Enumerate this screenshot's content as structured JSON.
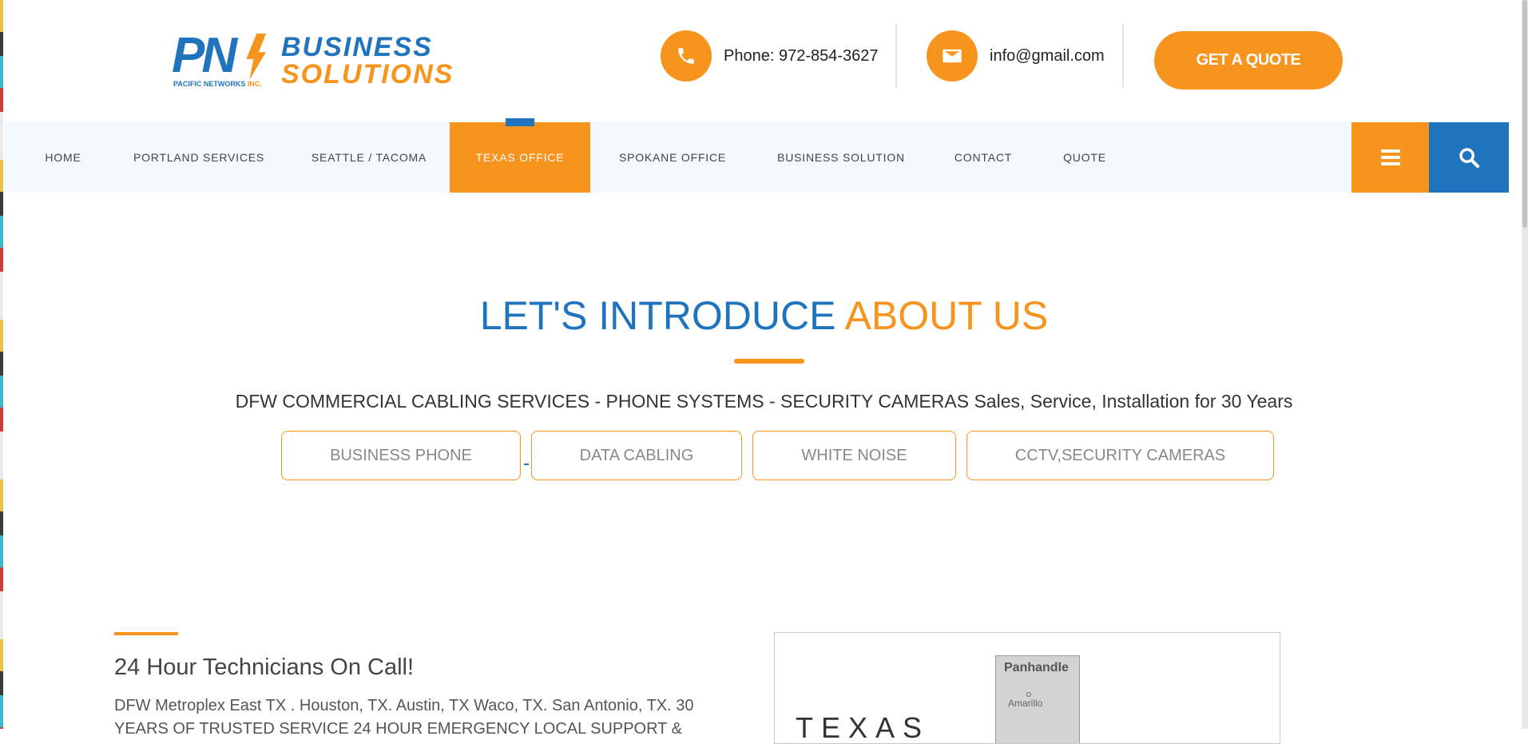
{
  "brand": {
    "mark": "PN",
    "company": "PACIFIC NETWORKS",
    "suffix": "INC.",
    "line1": "BUSINESS",
    "line2": "SOLUTIONS"
  },
  "header": {
    "phone_label": "Phone: 972-854-3627",
    "email_label": "info@gmail.com",
    "quote_button": "GET A QUOTE"
  },
  "nav": {
    "items": [
      {
        "label": "HOME"
      },
      {
        "label": "PORTLAND SERVICES"
      },
      {
        "label": "SEATTLE / TACOMA"
      },
      {
        "label": "TEXAS OFFICE"
      },
      {
        "label": "SPOKANE OFFICE"
      },
      {
        "label": "BUSINESS SOLUTION"
      },
      {
        "label": "CONTACT"
      },
      {
        "label": "QUOTE"
      }
    ],
    "active": "TEXAS OFFICE",
    "menu_icon": "hamburger-icon",
    "search_icon": "search-icon"
  },
  "hero": {
    "title_main": "LET'S INTRODUCE ",
    "title_accent": "ABOUT US",
    "subtitle": "DFW COMMERCIAL CABLING SERVICES - PHONE SYSTEMS - SECURITY CAMERAS Sales, Service, Installation for 30 Years",
    "services": [
      "BUSINESS PHONE",
      "DATA CABLING",
      "WHITE NOISE",
      "CCTV,SECURITY CAMERAS"
    ]
  },
  "section": {
    "title": "24 Hour Technicians  On Call!",
    "text": "DFW Metroplex East TX . Houston, TX. Austin, TX  Waco, TX. San Antonio, TX. 30 YEARS OF TRUSTED SERVICE 24 HOUR EMERGENCY LOCAL SUPPORT &"
  },
  "map": {
    "region": "Panhandle",
    "city": "Amarillo",
    "state": "TEXAS"
  },
  "colors": {
    "brand_blue": "#1f74bd",
    "brand_orange": "#f7941d",
    "nav_bg": "#f3f9fd"
  }
}
